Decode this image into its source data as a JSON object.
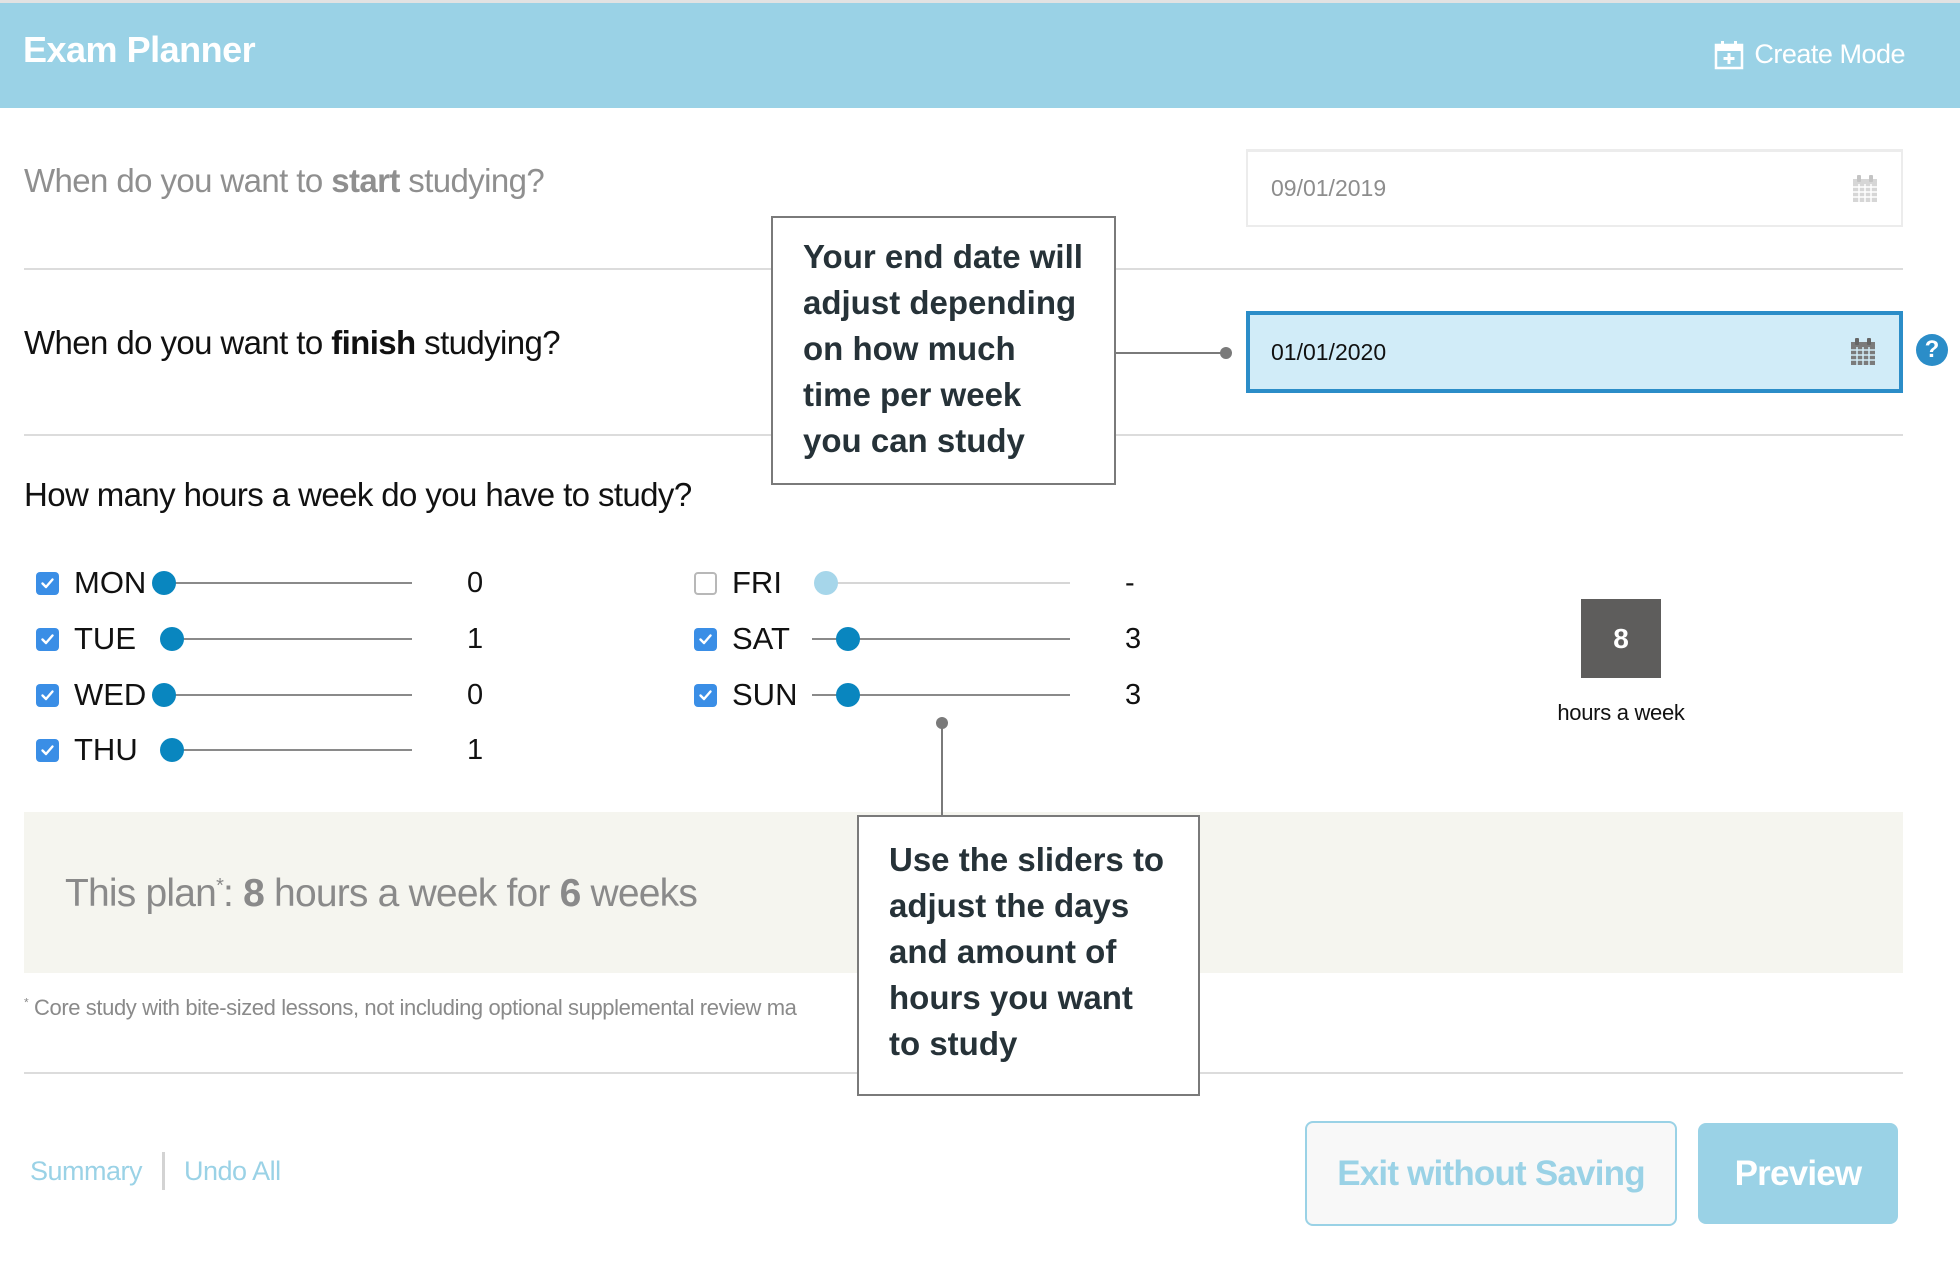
{
  "header": {
    "title": "Exam Planner",
    "create_mode_label": "Create Mode",
    "create_mode_icon": "calendar-plus-icon",
    "background_color": "#9ad2e6"
  },
  "start": {
    "question_prefix": "When do you want to ",
    "question_bold": "start",
    "question_suffix": " studying?",
    "date_value": "09/01/2019",
    "icon": "calendar-icon"
  },
  "finish": {
    "question_prefix": "When do you want to ",
    "question_bold": "finish",
    "question_suffix": " studying?",
    "date_value": "01/01/2020",
    "icon": "calendar-icon",
    "help_icon_label": "?",
    "focus_color": "#2b8dc8"
  },
  "hours": {
    "question": "How many hours a week do you have to study?",
    "slider_max_hours": 8,
    "days": [
      {
        "label": "MON",
        "checked": true,
        "value": 0,
        "display": "0"
      },
      {
        "label": "TUE",
        "checked": true,
        "value": 1,
        "display": "1"
      },
      {
        "label": "WED",
        "checked": true,
        "value": 0,
        "display": "0"
      },
      {
        "label": "THU",
        "checked": true,
        "value": 1,
        "display": "1"
      },
      {
        "label": "FRI",
        "checked": false,
        "value": null,
        "display": "-"
      },
      {
        "label": "SAT",
        "checked": true,
        "value": 3,
        "display": "3"
      },
      {
        "label": "SUN",
        "checked": true,
        "value": 3,
        "display": "3"
      }
    ],
    "total": "8",
    "total_label": "hours a week"
  },
  "plan": {
    "prefix": "This plan",
    "asterisk": "*",
    "colon": ": ",
    "hours": "8",
    "middle": " hours a week for ",
    "weeks": "6",
    "suffix": " weeks",
    "footnote_mark": "*",
    "footnote": "Core study with bite-sized lessons, not including optional supplemental review ma"
  },
  "footer": {
    "summary_link": "Summary",
    "undo_link": "Undo All",
    "exit_button": "Exit without Saving",
    "preview_button": "Preview"
  },
  "callouts": {
    "end_date": "Your end date will adjust depending on how much time per week you can study",
    "sliders": "Use the sliders to adjust the days and amount of hours you want to study"
  }
}
